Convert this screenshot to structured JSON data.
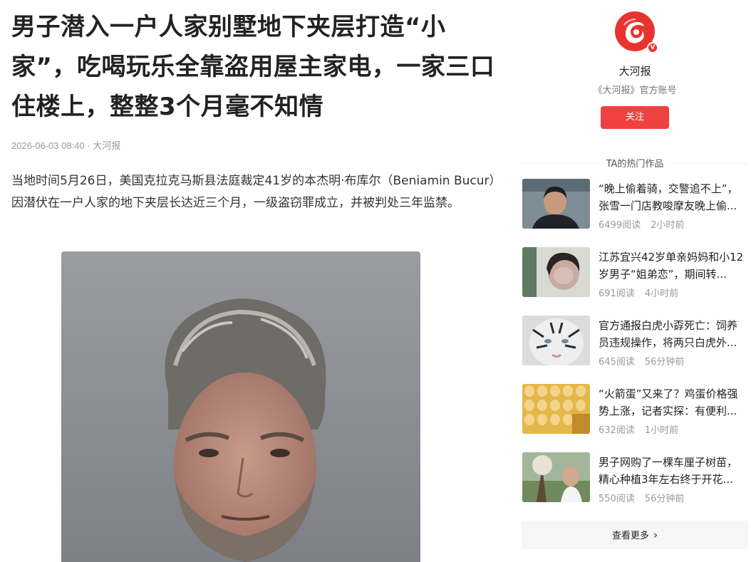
{
  "article": {
    "title": "男子潜入一户人家别墅地下夹层打造“小家”，吃喝玩乐全靠盗用屋主家电，一家三口住楼上，整整3个月毫不知情",
    "date": "2026-06-03 08:40",
    "separator": " · ",
    "source": "大河报",
    "paragraph": "当地时间5月26日，美国克拉克马斯县法庭裁定41岁的本杰明·布库尔（Beniamin Bucur）因潜伏在一户人家的地下夹层长达近三个月，一级盗窃罪成立，并被判处三年监禁。"
  },
  "author": {
    "name": "大河报",
    "description": "《大河报》官方账号",
    "follow_label": "关注",
    "logo_badge": "V",
    "logo_color": "#e8342e"
  },
  "hot": {
    "header": "TA的热门作品",
    "items": [
      {
        "title": "“晚上偷着骑，交警追不上”，张雪一门店教唆摩友晚上偷...",
        "reads": "6499阅读",
        "time": "2小时前"
      },
      {
        "title": "江苏宜兴42岁单亲妈妈和小12岁男子“姐弟恋”，期间转...",
        "reads": "691阅读",
        "time": "4小时前"
      },
      {
        "title": "官方通报白虎小孬死亡：饲养员违规操作，将两只白虎外...",
        "reads": "645阅读",
        "time": "56分钟前"
      },
      {
        "title": "“火箭蛋”又来了？鸡蛋价格强势上涨，记者实探：有便利...",
        "reads": "632阅读",
        "time": "1小时前"
      },
      {
        "title": "男子网购了一棵车厘子树苗，精心种植3年左右终于开花...",
        "reads": "550阅读",
        "time": "56分钟前"
      }
    ],
    "more_label": "查看更多",
    "more_arrow": "›"
  },
  "colors": {
    "accent": "#f04142",
    "muted": "#999999"
  }
}
